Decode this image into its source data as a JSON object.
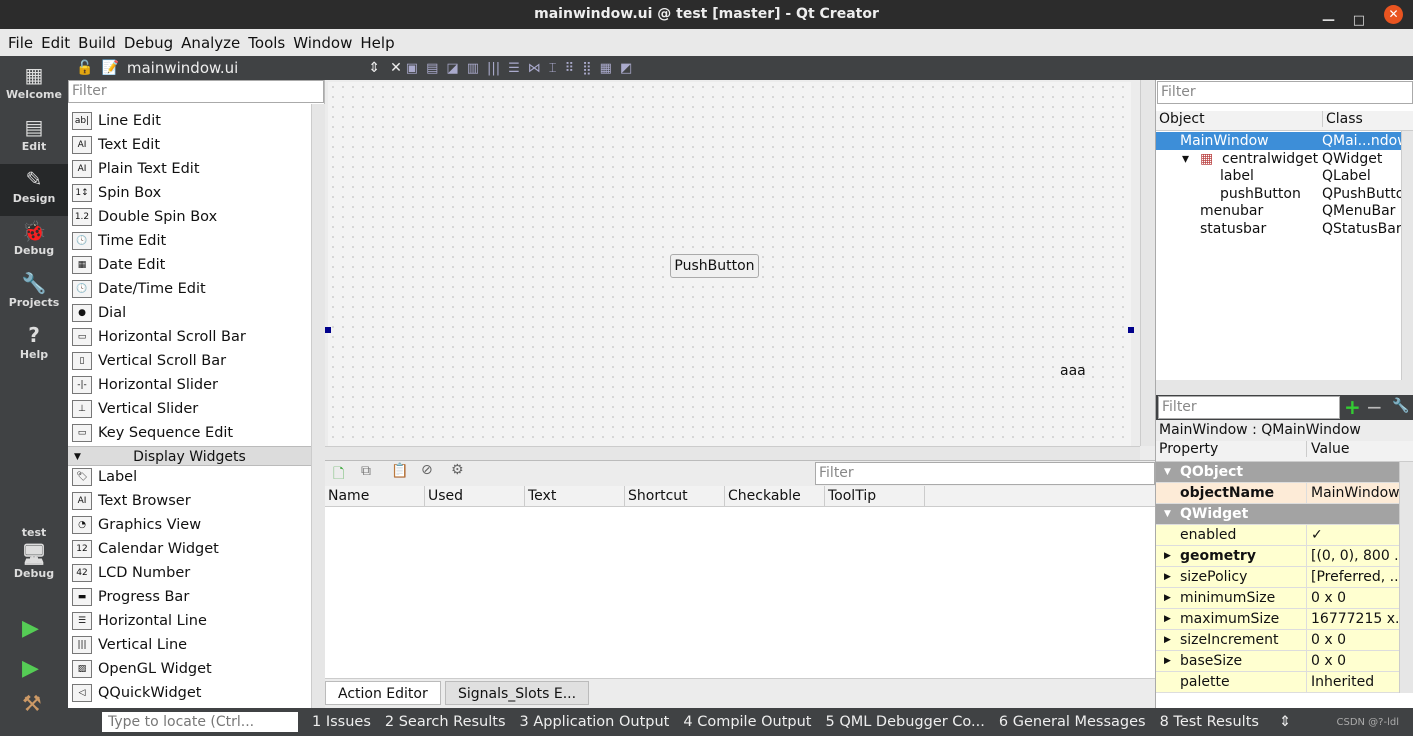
{
  "window": {
    "title": "mainwindow.ui @ test [master] - Qt Creator"
  },
  "menu": [
    "File",
    "Edit",
    "Build",
    "Debug",
    "Analyze",
    "Tools",
    "Window",
    "Help"
  ],
  "modes": [
    {
      "label": "Welcome",
      "icon": "grid-icon"
    },
    {
      "label": "Edit",
      "icon": "document-icon"
    },
    {
      "label": "Design",
      "icon": "pencil-icon"
    },
    {
      "label": "Debug",
      "icon": "bug-icon"
    },
    {
      "label": "Projects",
      "icon": "wrench-icon"
    },
    {
      "label": "Help",
      "icon": "question-icon"
    }
  ],
  "kit": {
    "project": "test",
    "mode": "Debug"
  },
  "editor": {
    "file": "mainwindow.ui"
  },
  "widgetbox": {
    "filter_placeholder": "Filter",
    "input_items": [
      "Line Edit",
      "Text Edit",
      "Plain Text Edit",
      "Spin Box",
      "Double Spin Box",
      "Time Edit",
      "Date Edit",
      "Date/Time Edit",
      "Dial",
      "Horizontal Scroll Bar",
      "Vertical Scroll Bar",
      "Horizontal Slider",
      "Vertical Slider",
      "Key Sequence Edit"
    ],
    "category": "Display Widgets",
    "display_items": [
      "Label",
      "Text Browser",
      "Graphics View",
      "Calendar Widget",
      "LCD Number",
      "Progress Bar",
      "Horizontal Line",
      "Vertical Line",
      "OpenGL Widget",
      "QQuickWidget"
    ]
  },
  "form": {
    "button": "PushButton",
    "label": "aaa"
  },
  "action_editor": {
    "filter_placeholder": "Filter",
    "columns": [
      "Name",
      "Used",
      "Text",
      "Shortcut",
      "Checkable",
      "ToolTip"
    ],
    "tabs": [
      "Action Editor",
      "Signals_Slots E..."
    ]
  },
  "object_inspector": {
    "filter_placeholder": "Filter",
    "columns": [
      "Object",
      "Class"
    ],
    "rows": [
      {
        "object": "MainWindow",
        "class": "QMai...ndow",
        "level": 0,
        "selected": true
      },
      {
        "object": "centralwidget",
        "class": "QWidget",
        "level": 1
      },
      {
        "object": "label",
        "class": "QLabel",
        "level": 2
      },
      {
        "object": "pushButton",
        "class": "QPushButto",
        "level": 2
      },
      {
        "object": "menubar",
        "class": "QMenuBar",
        "level": 1
      },
      {
        "object": "statusbar",
        "class": "QStatusBar",
        "level": 1
      }
    ]
  },
  "property_editor": {
    "filter_placeholder": "Filter",
    "title": "MainWindow : QMainWindow",
    "columns": [
      "Property",
      "Value"
    ],
    "rows": [
      {
        "name": "QObject",
        "group": true
      },
      {
        "name": "objectName",
        "value": "MainWindow",
        "bold": true
      },
      {
        "name": "QWidget",
        "group": true
      },
      {
        "name": "enabled",
        "value": "✓"
      },
      {
        "name": "geometry",
        "value": "[(0, 0), 800 ...",
        "bold": true,
        "expand": true
      },
      {
        "name": "sizePolicy",
        "value": "[Preferred, ..",
        "expand": true
      },
      {
        "name": "minimumSize",
        "value": "0 x 0",
        "expand": true
      },
      {
        "name": "maximumSize",
        "value": "16777215 x..",
        "expand": true
      },
      {
        "name": "sizeIncrement",
        "value": "0 x 0",
        "expand": true
      },
      {
        "name": "baseSize",
        "value": "0 x 0",
        "expand": true
      },
      {
        "name": "palette",
        "value": "Inherited"
      }
    ]
  },
  "statusbar": {
    "locate_placeholder": "Type to locate (Ctrl...",
    "outputs": [
      "1  Issues",
      "2  Search Results",
      "3  Application Output",
      "4  Compile Output",
      "5  QML Debugger Co...",
      "6  General Messages",
      "8  Test Results"
    ],
    "watermark": "CSDN @?-ldl"
  }
}
